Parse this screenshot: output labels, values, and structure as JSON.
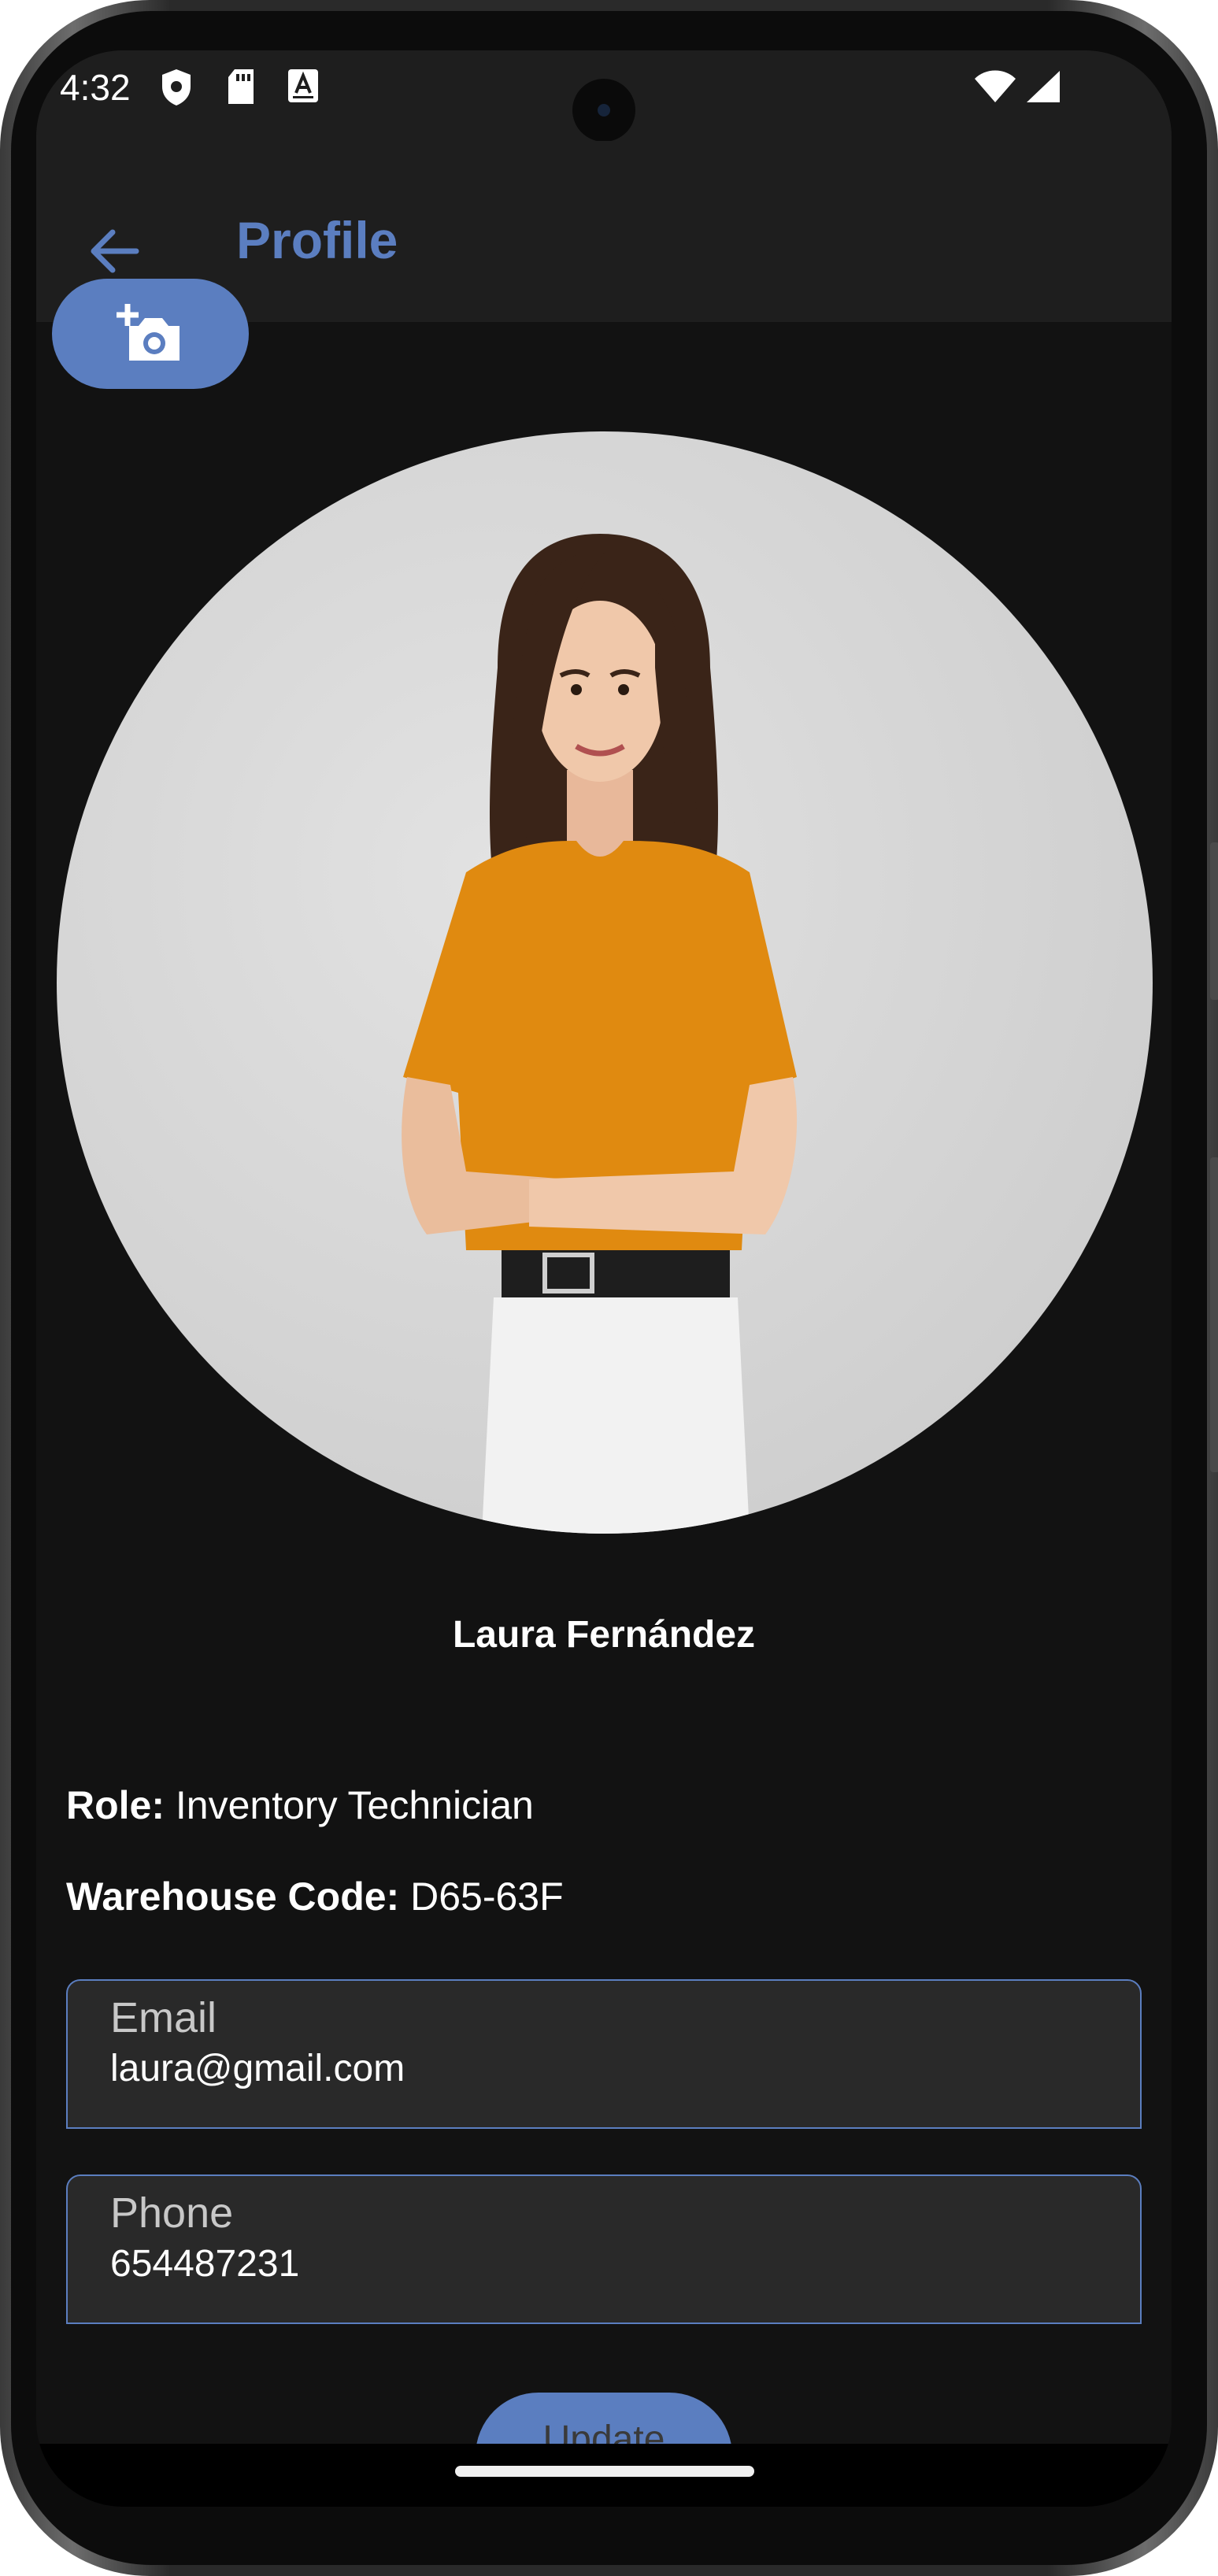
{
  "status_bar": {
    "time": "4:32",
    "icons": [
      "shield-icon",
      "sd-card-icon",
      "keyboard-a-icon",
      "wifi-icon",
      "cell-signal-icon"
    ]
  },
  "app_bar": {
    "title": "Profile",
    "back_icon": "arrow-back-icon",
    "accent_color": "#5b7ec0"
  },
  "photo_button": {
    "icon": "add-a-photo-icon"
  },
  "profile": {
    "name": "Laura Fernández",
    "role_label": "Role:",
    "role_value": "Inventory Technician",
    "warehouse_label": "Warehouse Code:",
    "warehouse_value": "D65-63F"
  },
  "fields": {
    "email": {
      "label": "Email",
      "value": "laura@gmail.com"
    },
    "phone": {
      "label": "Phone",
      "value": "654487231"
    }
  },
  "update_button": {
    "label": "Update"
  },
  "colors": {
    "background": "#121212",
    "surface": "#1e1e1e",
    "field_fill": "#292929",
    "primary": "#5b7ec0",
    "shirt": "#e08a10"
  }
}
